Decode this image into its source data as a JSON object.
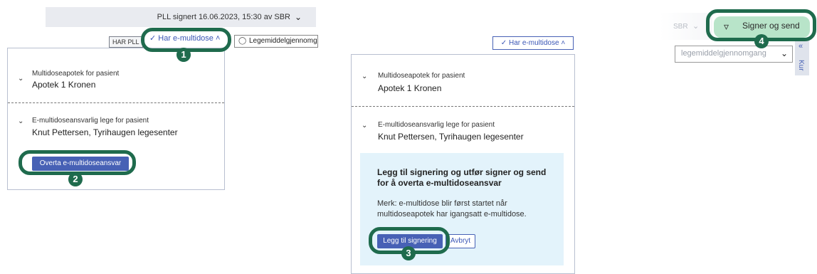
{
  "panel1": {
    "status_text": "PLL signert 16.06.2023, 15:30 av SBR",
    "badge_pll": "HAR PLL",
    "toggle_label": "Har e-multidose",
    "legemiddel_label": "Legemiddelgjennomg",
    "pharmacy_label": "Multidoseapotek for pasient",
    "pharmacy_value": "Apotek 1 Kronen",
    "doctor_label": "E-multidoseansvarlig lege for pasient",
    "doctor_value": "Knut Pettersen,  Tyrihaugen legesenter",
    "takeover_button": "Overta e-multidoseansvar",
    "marker1": "1",
    "marker2": "2"
  },
  "panel2": {
    "toggle_label": "Har e-multidose",
    "pharmacy_label": "Multidoseapotek for pasient",
    "pharmacy_value": "Apotek 1 Kronen",
    "doctor_label": "E-multidoseansvarlig lege for pasient",
    "doctor_value": "Knut Pettersen,  Tyrihaugen legesenter",
    "info_title_line1": "Legg til signering og utfør signer og send",
    "info_title_line2": "for å overta e-multidoseansvar",
    "info_note_line1": "Merk: e-multidose blir først startet når",
    "info_note_line2": "multidoseapotek har igangsatt e-multidose.",
    "add_signing_button": "Legg til signering",
    "cancel_button": "Avbryt",
    "marker3": "3"
  },
  "panel3": {
    "sbr_text": "SBR",
    "sign_button": "Signer og send",
    "select_text": "legemiddelgjennomgang",
    "side_tab_text": "Kur",
    "marker4": "4"
  },
  "icons": {
    "check": "check-icon",
    "chevron_down": "chevron-down-icon",
    "chevron_up": "chevron-up-icon",
    "shield": "shield-icon",
    "send": "send-icon",
    "double_chevron": "double-chevron-left-icon"
  },
  "colors": {
    "highlight_ring": "#1f6b4d",
    "primary_button": "#4761b5",
    "info_box": "#e3f3fb",
    "sign_button": "#b8e4c9"
  }
}
